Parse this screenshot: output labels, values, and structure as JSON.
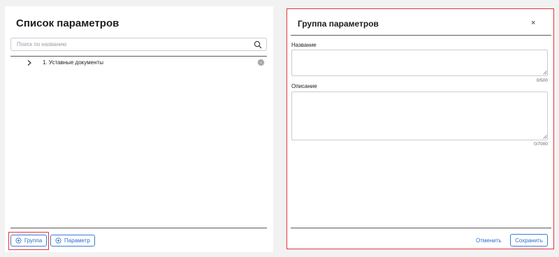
{
  "left_panel": {
    "title": "Список параметров",
    "search": {
      "placeholder": "Поиск по названию",
      "value": "",
      "icon": "search-icon"
    },
    "tree": [
      {
        "label": "1. Уставные документы",
        "icon": "chevron-right-icon",
        "action_icon": "gear-icon"
      }
    ],
    "footer": {
      "add_group_label": "Группа",
      "add_param_label": "Параметр",
      "add_icon": "plus-circle-icon"
    }
  },
  "dialog": {
    "title": "Группа параметров",
    "close_label": "×",
    "fields": {
      "name": {
        "label": "Название",
        "value": "",
        "counter": "0/500"
      },
      "description": {
        "label": "Описание",
        "value": "",
        "counter": "0/7000"
      }
    },
    "cancel_label": "Отменить",
    "save_label": "Сохранить"
  },
  "colors": {
    "accent": "#2a6fcf",
    "highlight": "#e5343c",
    "background": "#f2f2f2"
  }
}
